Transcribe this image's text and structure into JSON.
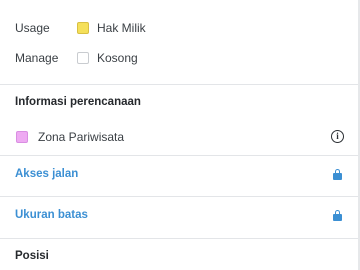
{
  "colors": {
    "accent": "#3b8fd3",
    "usage_swatch": "#f5e05a",
    "usage_swatch_border": "#d8c043",
    "manage_swatch": "#ffffff",
    "manage_swatch_border": "#c9ccd0",
    "zone_swatch": "#eeaaf2",
    "divider": "#e3e5e8"
  },
  "meta": {
    "usage_label": "Usage",
    "usage_value": "Hak Milik",
    "manage_label": "Manage",
    "manage_value": "Kosong"
  },
  "planning": {
    "title": "Informasi perencanaan",
    "zone_label": "Zona Pariwisata",
    "zone_icon": "info-icon"
  },
  "links": [
    {
      "label": "Akses jalan",
      "icon": "lock-icon"
    },
    {
      "label": "Ukuran batas",
      "icon": "lock-icon"
    }
  ],
  "position": {
    "title": "Posisi"
  }
}
